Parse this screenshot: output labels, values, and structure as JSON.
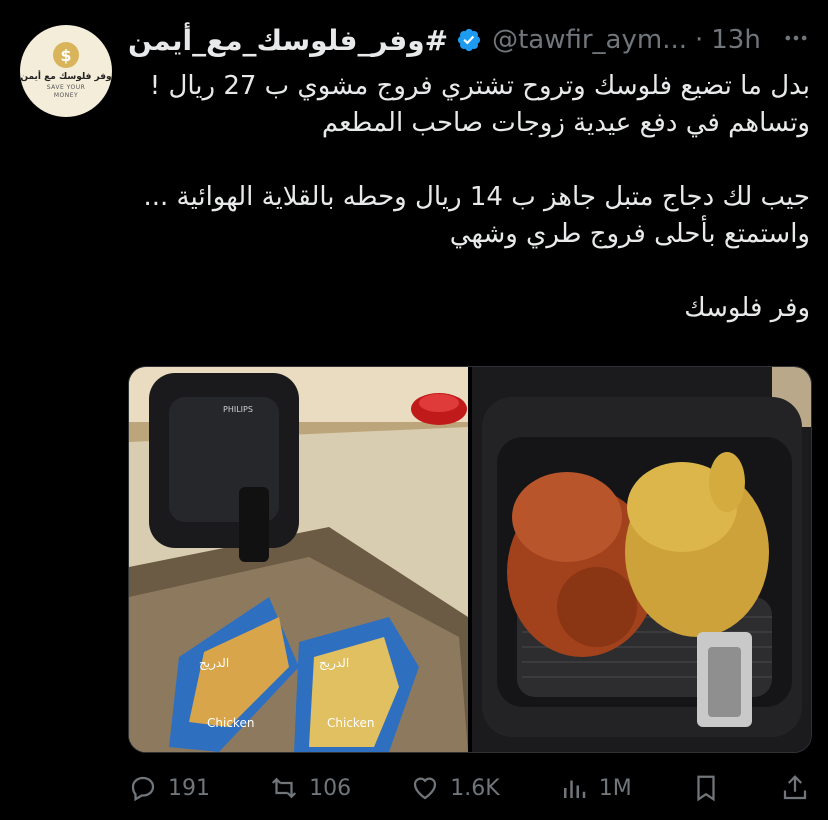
{
  "author": {
    "display_name": "#وفر_فلوسك_مع_أيمن",
    "handle": "@tawfir_aym...",
    "separator": "·",
    "timestamp": "13h",
    "more_icon": "more-horizontal-icon",
    "avatar": {
      "title": "وفر فلوسك مع أيمن",
      "subtitle": "SAVE YOUR MONEY",
      "symbol": "$"
    }
  },
  "tweet": {
    "text": "بدل ما تضيع فلوسك وتروح تشتري فروج مشوي ب 27 ريال ! وتساهم في دفع عيدية زوجات صاحب المطعم\n\nجيب لك دجاج متبل جاهز ب 14 ريال وحطه بالقلاية الهوائية ... واستمتع بأحلى فروج طري وشهي\n\nوفر فلوسك"
  },
  "media": {
    "left_photo": {
      "brand": "PHILIPS",
      "package_1_brand": "الدريج",
      "package_1_label": "Chicken",
      "package_2_brand": "الدريج",
      "package_2_label": "Chicken"
    },
    "right_photo": {}
  },
  "actions": {
    "reply_count": "191",
    "retweet_count": "106",
    "like_count": "1.6K",
    "views_count": "1M"
  },
  "colors": {
    "background": "#000000",
    "text": "#e7e9ea",
    "muted": "#71767b",
    "verified": "#1d9bf0"
  }
}
